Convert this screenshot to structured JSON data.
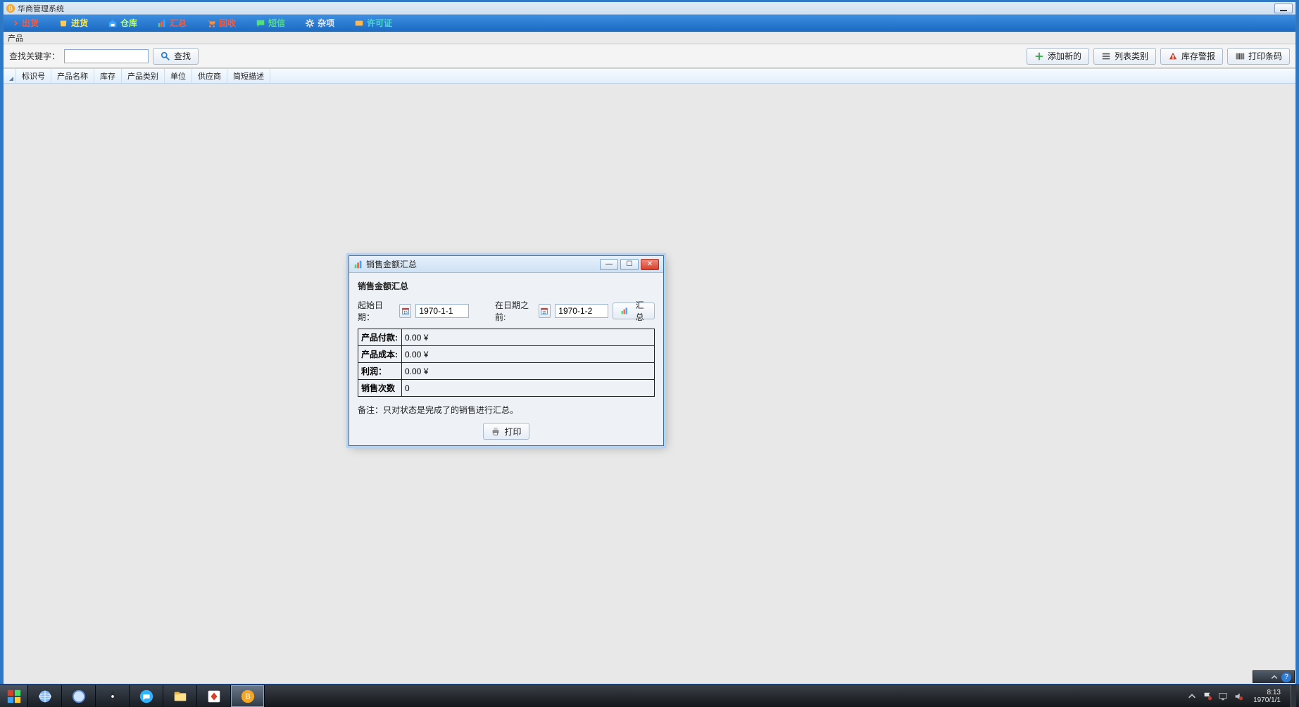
{
  "window": {
    "title": "华商管理系统"
  },
  "ribbon": {
    "items": [
      {
        "label": "出货",
        "cls": "red"
      },
      {
        "label": "进货",
        "cls": ""
      },
      {
        "label": "仓库",
        "cls": "lime"
      },
      {
        "label": "汇总",
        "cls": "red"
      },
      {
        "label": "回收",
        "cls": "red"
      },
      {
        "label": "短信",
        "cls": "green"
      },
      {
        "label": "杂项",
        "cls": "gray"
      },
      {
        "label": "许可证",
        "cls": "teal"
      }
    ]
  },
  "subheader": {
    "title": "产品"
  },
  "toolbar": {
    "search_label": "查找关键字：",
    "search_value": "",
    "search_button": "查找",
    "add_new": "添加新的",
    "list_category": "列表类别",
    "stock_alert": "库存警报",
    "print_barcode": "打印条码"
  },
  "columns": [
    "标识号",
    "产品名称",
    "库存",
    "产品类别",
    "单位",
    "供应商",
    "简短描述"
  ],
  "dialog": {
    "title": "销售金额汇总",
    "heading": "销售金额汇总",
    "start_label": "起始日期：",
    "start_value": "1970-1-1",
    "end_label": "在日期之前:",
    "end_value": "1970-1-2",
    "sum_button": "汇总",
    "rows": [
      {
        "k": "产品付款:",
        "v": "0.00 ¥"
      },
      {
        "k": "产品成本:",
        "v": "0.00 ¥"
      },
      {
        "k": "利润：",
        "v": "0.00 ¥"
      },
      {
        "k": "销售次数",
        "v": "0"
      }
    ],
    "note": "备注：只对状态是完成了的销售进行汇总。",
    "print": "打印"
  },
  "tray": {
    "time": "8:13",
    "date": "1970/1/1"
  }
}
